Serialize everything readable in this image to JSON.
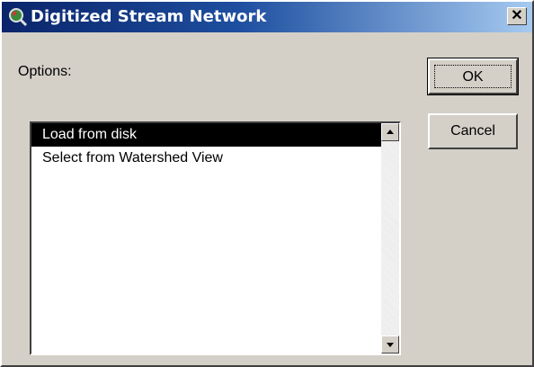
{
  "window": {
    "title": "Digitized Stream Network",
    "close_symbol": "✕",
    "app_icon": "magnifier-globe-icon"
  },
  "dialog": {
    "options_label": "Options:",
    "ok_label": "OK",
    "cancel_label": "Cancel"
  },
  "list": {
    "items": [
      {
        "label": "Load from disk",
        "selected": true
      },
      {
        "label": "Select from Watershed View",
        "selected": false
      }
    ]
  },
  "colors": {
    "title_gradient_start": "#0a246a",
    "title_gradient_end": "#a6caf0",
    "face": "#d4d0c8",
    "selection": "#000000"
  }
}
